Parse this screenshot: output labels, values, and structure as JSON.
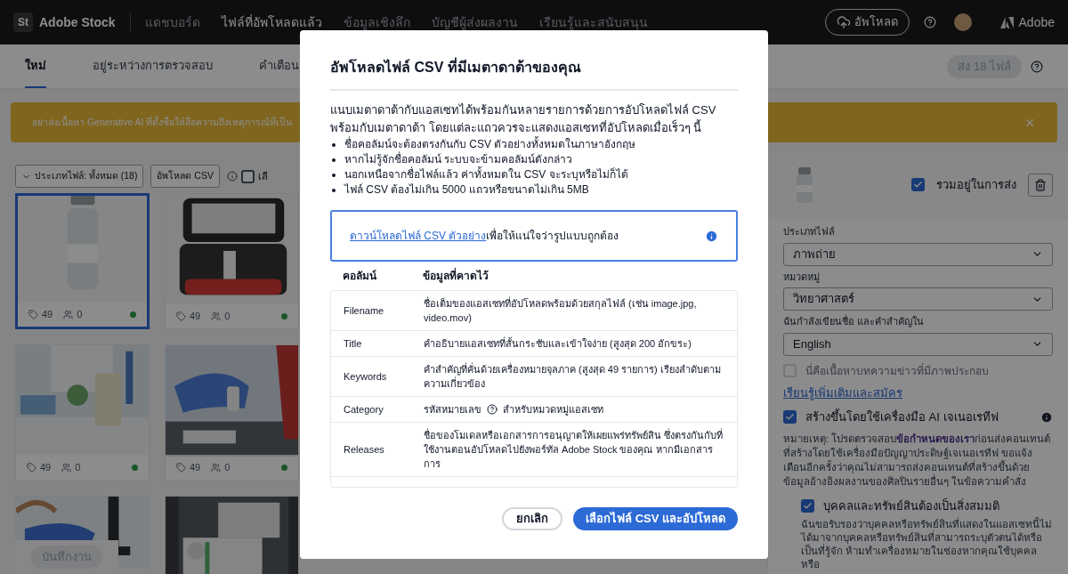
{
  "top_bar": {
    "logo_mark": "St",
    "brand": "Adobe Stock",
    "nav": [
      {
        "label": "แดชบอร์ด",
        "selected": false
      },
      {
        "label": "ไฟล์ที่อัพโหลดแล้ว",
        "selected": true
      },
      {
        "label": "ข้อมูลเชิงลึก",
        "selected": false
      },
      {
        "label": "บัญชีผู้ส่งผลงาน",
        "selected": false
      },
      {
        "label": "เรียนรู้และสนับสนุน",
        "selected": false
      }
    ],
    "upload_button": "อัพโหลด",
    "adobe_label": "Adobe"
  },
  "tabs": [
    {
      "label": "ใหม่",
      "selected": true
    },
    {
      "label": "อยู่ระหว่างการตรวจสอบ",
      "selected": false
    },
    {
      "label": "คำเตือน",
      "selected": false
    }
  ],
  "submit_button": {
    "label": "ส่ง 18 ไฟล์",
    "disabled": true
  },
  "banner": {
    "text": "อย่าส่งเนื้อหา Generative AI ที่ตั้งชื่อให้สื่อความถึงเหตุการณ์ที่เป็น"
  },
  "toolbar": {
    "filter": "ประเภทไฟล์: ทั้งหมด (18)",
    "upload_csv": "อัพโหลด CSV",
    "select_all": {
      "label": "เลื",
      "checked": false
    }
  },
  "assets": [
    {
      "kind": "picture",
      "selected": true,
      "keywords": "49",
      "releases": "0"
    },
    {
      "kind": "picture",
      "selected": false,
      "keywords": "49",
      "releases": "0"
    },
    {
      "kind": "picture",
      "selected": false,
      "keywords": "49",
      "releases": "0"
    },
    {
      "kind": "picture",
      "selected": false,
      "keywords": "49",
      "releases": "0"
    },
    {
      "kind": "picture",
      "selected": false
    },
    {
      "kind": "picture",
      "selected": false
    }
  ],
  "save_button": {
    "label": "บันทึกงาน",
    "disabled": true
  },
  "details": {
    "include": {
      "label": "รวมอยู่ในการส่ง",
      "checked": true
    },
    "fields": [
      {
        "label": "ประเภทไฟล์",
        "value": "ภาพถ่าย"
      },
      {
        "label": "หมวดหมู่",
        "value": "วิทยาศาสตร์"
      },
      {
        "label": "ฉันกำลังเขียนชื่อ และคำสำคัญใน",
        "value": "English"
      }
    ],
    "editorial": {
      "label": "นี่คือเนื้อหาบทความข่าวที่มีภาพประกอบ",
      "checked": false,
      "disabled": true
    },
    "learn_more_link": "เรียนรู้เพิ่มเติมและสมัคร",
    "generative_ai": {
      "label": "สร้างขึ้นโดยใช้เครื่องมือ AI เจเนอเรทีฟ",
      "checked": true
    },
    "note_before": "หมายเหตุ: โปรดตรวจสอบ",
    "note_link": "ข้อกำหนดของเรา",
    "note_after": "ก่อนส่งคอนเทนต์ที่สร้างโดยใช้เครื่องมือปัญญาประดิษฐ์เจเนอเรทีฟ ขอแจ้งเตือนอีกครั้งว่าคุณไม่สามารถส่งคอนเทนต์ที่สร้างขึ้นด้วยข้อมูลอ้างอิงผลงานของศิลปินรายอื่นๆ ในข้อความคำสั่ง",
    "fictional": {
      "label": "บุคคลและทรัพย์สินต้องเป็นสิ่งสมมติ",
      "checked": true
    },
    "fictional_text": "ฉันขอรับรองว่าบุคคลหรือทรัพย์สินที่แสดงในแอสเซทนี้ไม่ได้มาจากบุคคลหรือทรัพย์สินที่สามารถระบุตัวตนได้หรือเป็นที่รู้จัก ห้ามทำเครื่องหมายในช่องหากคุณใช้บุคคลหรือ"
  },
  "modal": {
    "title": "อัพโหลดไฟล์ CSV ที่มีเมตาดาต้าของคุณ",
    "intro": "แนบเมตาดาต้ากับแอสเซทได้พร้อมกันหลายรายการด้วยการอัปโหลดไฟล์ CSV พร้อมกับเมตาดาต้า โดยแต่ละแถวควรจะแสดงแอสเซทที่อัปโหลดเมื่อเร็วๆ นี้",
    "bullets": [
      "ชื่อคอลัมน์จะต้องตรงกันกับ CSV ตัวอย่างทั้งหมดในภาษาอังกฤษ",
      "หากไม่รู้จักชื่อคอลัมน์ ระบบจะข้ามคอลัมน์ดังกล่าว",
      "นอกเหนือจากชื่อไฟล์แล้ว ค่าทั้งหมดใน CSV จะระบุหรือไม่ก็ได้",
      "ไฟล์ CSV ต้องไม่เกิน 5000 แถวหรือขนาดไม่เกิน 5MB"
    ],
    "info": {
      "link": "ดาวน์โหลดไฟล์ CSV ตัวอย่าง",
      "text": "เพื่อให้แน่ใจว่ารูปแบบถูกต้อง"
    },
    "table": {
      "columns": [
        "คอลัมน์",
        "ข้อมูลที่คาดไว้"
      ],
      "rows": [
        {
          "column": "Filename",
          "description": "ชื่อเต็มของแอสเซทที่อัปโหลดพร้อมด้วยสกุลไฟล์ (เช่น image.jpg, video.mov)"
        },
        {
          "column": "Title",
          "description": "คำอธิบายแอสเซทที่สั้นกระชับและเข้าใจง่าย (สูงสุด 200 อักขระ)"
        },
        {
          "column": "Keywords",
          "description": "คำสำคัญที่คั่นด้วยเครื่องหมายจุลภาค (สูงสุด 49 รายการ) เรียงลำดับตามความเกี่ยวข้อง"
        },
        {
          "column": "Category",
          "kind": "help",
          "description": "รหัสหมายเลข",
          "description_after": "สำหรับหมวดหมู่แอสเซท"
        },
        {
          "column": "Releases",
          "description": "ชื่อของโมเดลหรือเอกสารการอนุญาตให้เผยแพร่ทรัพย์สิน ซึ่งตรงกันกับที่ใช้งานตอนอัปโหลดไปยังพอร์ทัล Adobe Stock ของคุณ หากมีเอกสารการ"
        }
      ]
    },
    "buttons": {
      "cancel": "ยกเลิก",
      "confirm": "เลือกไฟล์ CSV และอัปโหลด"
    }
  }
}
